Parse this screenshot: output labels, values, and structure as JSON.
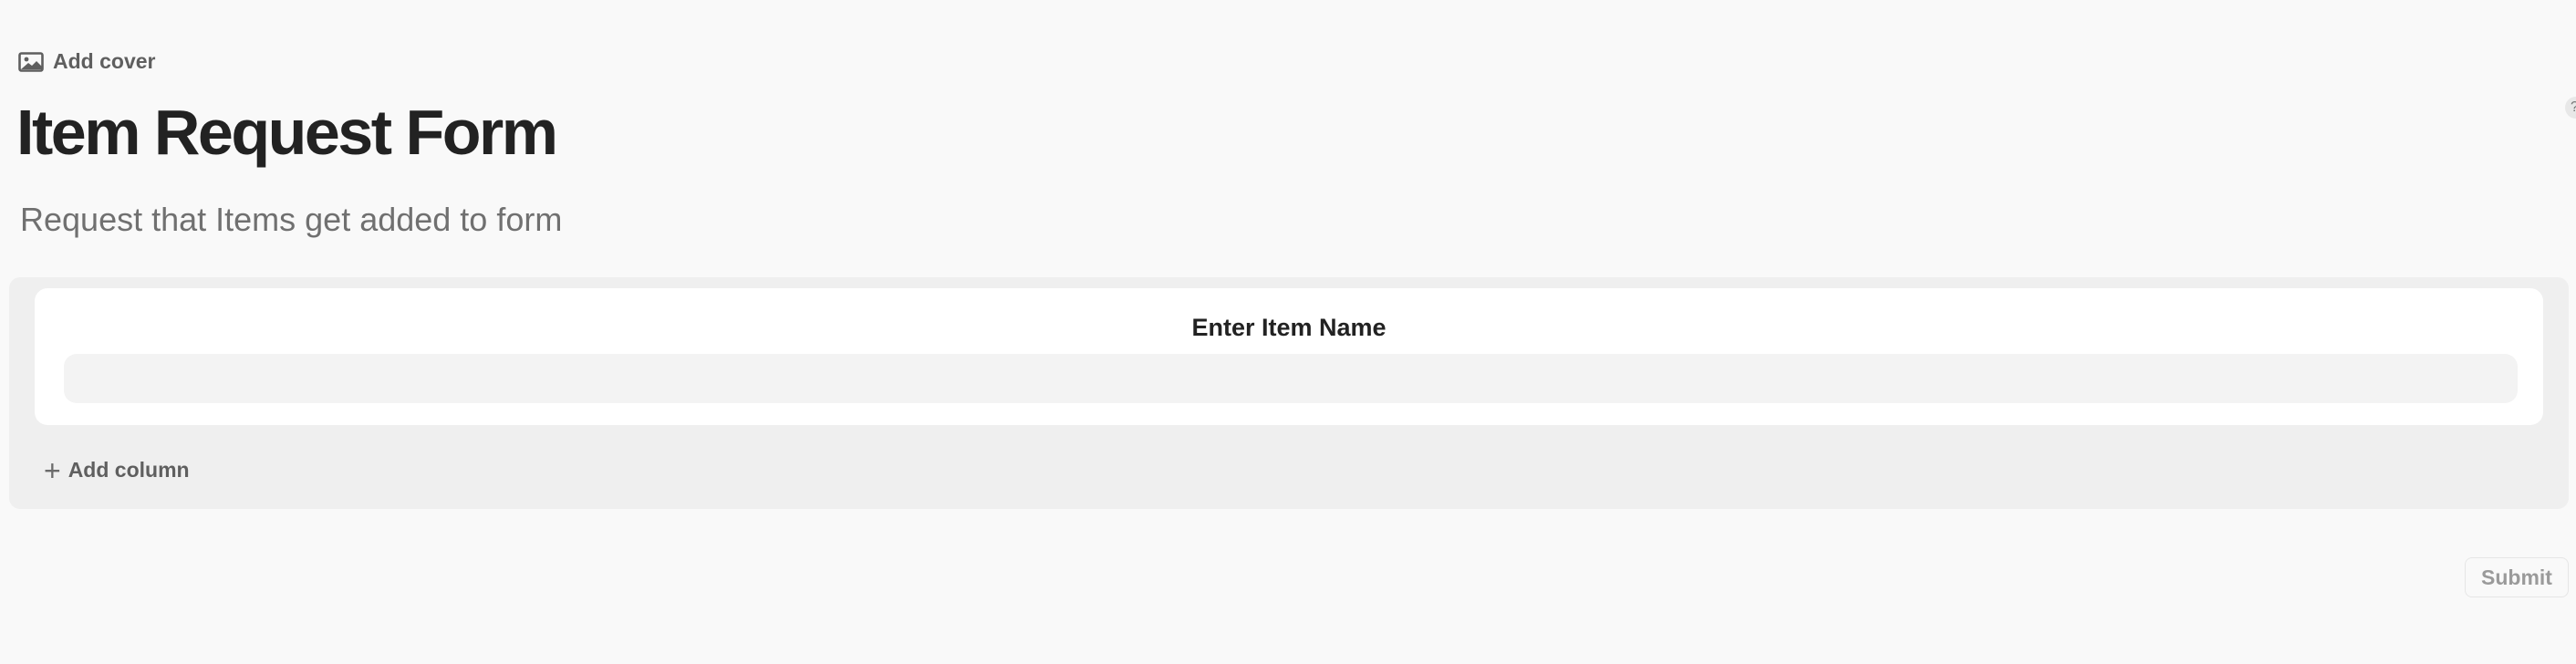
{
  "header": {
    "add_cover_label": "Add cover",
    "icons": {
      "cover": "image-icon"
    }
  },
  "form": {
    "title": "Item Request Form",
    "description": "Request that Items get added to form",
    "columns": [
      {
        "label": "Enter Item Name",
        "value": "",
        "placeholder": ""
      }
    ],
    "add_column_label": "Add column",
    "submit_label": "Submit"
  },
  "help": {
    "glyph": "?"
  },
  "colors": {
    "background": "#f9f9f9",
    "panel": "#efefef",
    "card": "#ffffff",
    "input": "#f3f3f3",
    "title": "#222222",
    "muted": "#707070"
  }
}
